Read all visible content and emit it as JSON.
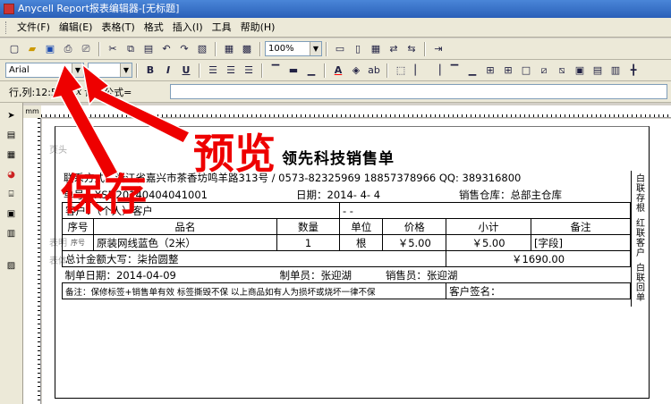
{
  "window": {
    "title": "Anycell Report报表编辑器-[无标题]"
  },
  "menu": [
    "文件(F)",
    "编辑(E)",
    "表格(T)",
    "格式",
    "插入(I)",
    "工具",
    "帮助(H)"
  ],
  "toolbar1": {
    "zoom": "100%"
  },
  "toolbar2": {
    "font": "Arial",
    "size": ""
  },
  "toolbar3": {
    "cellref": "行,列:12:5",
    "fx": "fx",
    "formula_label": "计算公式="
  },
  "ruler": {
    "unit": "mm"
  },
  "canvas": {
    "band_header": "页头",
    "band_body": "表明",
    "band_detail": "表体",
    "title": "领先科技销售单",
    "line1": "联系方式：浙江省嘉兴市茶香坊鸣羊路313号 / 0573-82325969 18857378966 QQ: 389316800",
    "order_no": "单号：XSD20140404041001",
    "date": "日期：2014- 4- 4",
    "warehouse": "销售仓库：总部主仓库",
    "customer": "客户：（个人）客户",
    "customer_tel": "- -",
    "headers": [
      "序号",
      "品名",
      "数量",
      "单位",
      "价格",
      "小计",
      "备注"
    ],
    "row": [
      "序号",
      "原装网线蓝色（2米）",
      "1",
      "根",
      "￥5.00",
      "￥5.00",
      "[字段]"
    ],
    "total_label": "总计金额大写：柒拾圆整",
    "total_value": "￥1690.00",
    "made_date": "制单日期：2014-04-09",
    "maker": "制单员：张迎湖",
    "salesman": "销售员：张迎湖",
    "note": "备注：保修标签+销售单有效  标签撕毁不保  以上商品如有人为损坏或烧坏一律不保",
    "sign": "客户签名：",
    "side1": "白联存根",
    "side2": "红联客户",
    "side3": "白联回单"
  },
  "annotations": {
    "save": "保存",
    "preview": "预览"
  },
  "colors": {
    "annotation": "#e00000",
    "titlebar": "#2a5fb8"
  }
}
